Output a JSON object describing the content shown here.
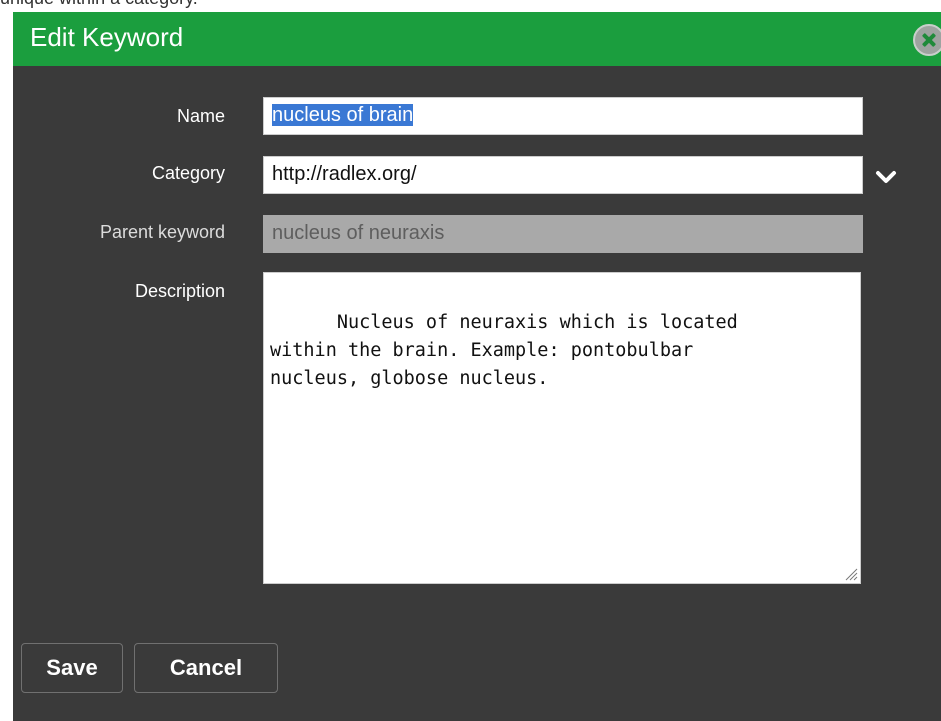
{
  "background_text": "unique within a category.",
  "dialog": {
    "title": "Edit Keyword",
    "close_icon": "close-circle-icon"
  },
  "form": {
    "name": {
      "label": "Name",
      "value": "nucleus of brain"
    },
    "category": {
      "label": "Category",
      "value": "http://radlex.org/",
      "dropdown_icon": "chevron-down-icon"
    },
    "parent_keyword": {
      "label": "Parent keyword",
      "value": "nucleus of neuraxis"
    },
    "description": {
      "label": "Description",
      "value": "Nucleus of neuraxis which is located\nwithin the brain. Example: pontobulbar\nnucleus, globose nucleus."
    }
  },
  "buttons": {
    "save": "Save",
    "cancel": "Cancel"
  },
  "colors": {
    "titlebar": "#1b9e3e",
    "dialog_body": "#3a3a3a",
    "selection": "#3a78d4"
  }
}
